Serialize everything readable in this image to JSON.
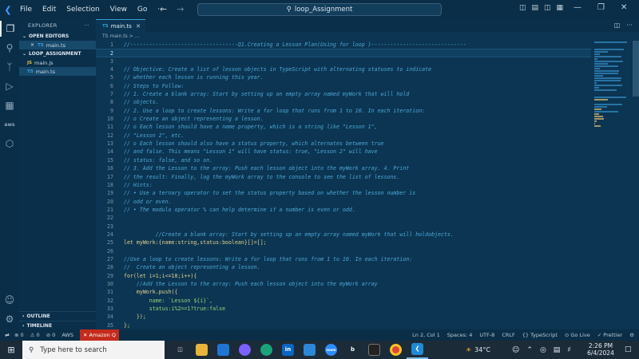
{
  "menu": [
    "File",
    "Edit",
    "Selection",
    "View",
    "Go"
  ],
  "menu_more": "···",
  "command_center": {
    "text": "loop_Assignment"
  },
  "sidebar": {
    "title": "EXPLORER",
    "open_editors_label": "OPEN EDITORS",
    "open_editor_file": "main.ts",
    "project_label": "LOOP_ASSIGNMENT",
    "files": [
      {
        "badge": "JS",
        "name": "main.js"
      },
      {
        "badge": "TS",
        "name": "main.ts"
      }
    ],
    "outline_label": "OUTLINE",
    "timeline_label": "TIMELINE"
  },
  "editor": {
    "tab_badge": "TS",
    "tab_label": "main.ts",
    "breadcrumb": "TS main.ts > ...",
    "lines": [
      {
        "n": "1",
        "t": "//----------------------------------Q1.Creating a Lesson Plan(Using for loop )------------------------------",
        "cls": "c"
      },
      {
        "n": "2",
        "t": "",
        "cls": "c",
        "cur": true
      },
      {
        "n": "3",
        "t": "",
        "cls": "c"
      },
      {
        "n": "4",
        "t": "// Objective: Create a list of lesson objects in TypeScript with alternating statuses to indicate",
        "cls": "c"
      },
      {
        "n": "5",
        "t": "// whether each lesson is running this year.",
        "cls": "c"
      },
      {
        "n": "6",
        "t": "// Steps to Follow:",
        "cls": "c"
      },
      {
        "n": "7",
        "t": "// 1. Create a blank array: Start by setting up an empty array named myWork that will hold",
        "cls": "c"
      },
      {
        "n": "8",
        "t": "// objects.",
        "cls": "c"
      },
      {
        "n": "9",
        "t": "// 2. Use a loop to create lessons: Write a for loop that runs from 1 to 10. In each iteration:",
        "cls": "c"
      },
      {
        "n": "10",
        "t": "// o Create an object representing a lesson.",
        "cls": "c"
      },
      {
        "n": "11",
        "t": "// o Each lesson should have a name property, which is a string like \"Lesson 1\",",
        "cls": "c"
      },
      {
        "n": "12",
        "t": "// \"Lesson 2\", etc.",
        "cls": "c"
      },
      {
        "n": "13",
        "t": "// o Each lesson should also have a status property, which alternates between true",
        "cls": "c"
      },
      {
        "n": "14",
        "t": "// and false. This means \"Lesson 1\" will have status: true, \"Lesson 2\" will have",
        "cls": "c"
      },
      {
        "n": "15",
        "t": "// status: false, and so on.",
        "cls": "c"
      },
      {
        "n": "16",
        "t": "// 3. Add the Lesson to the array: Push each lesson object into the myWork array. 4. Print",
        "cls": "c"
      },
      {
        "n": "17",
        "t": "// the result: Finally, log the myWork array to the console to see the list of lessons.",
        "cls": "c"
      },
      {
        "n": "18",
        "t": "// Hints:",
        "cls": "c"
      },
      {
        "n": "19",
        "t": "// • Use a ternary operator to set the status property based on whether the lesson number is",
        "cls": "c"
      },
      {
        "n": "20",
        "t": "// odd or even.",
        "cls": "c"
      },
      {
        "n": "21",
        "t": "// • The modulo operator % can help determine if a number is even or odd.",
        "cls": "c"
      },
      {
        "n": "22",
        "t": "",
        "cls": "c"
      },
      {
        "n": "23",
        "t": "",
        "cls": "c"
      },
      {
        "n": "24",
        "t": "          //Create a blank array: Start by setting up an empty array named myWork that will holdobjects.",
        "cls": "c"
      },
      {
        "n": "25",
        "t": "let myWork:{name:string,status:boolean}[]=[];",
        "cls": "k"
      },
      {
        "n": "26",
        "t": "",
        "cls": "c"
      },
      {
        "n": "27",
        "t": "//Use a loop to create lessons: Write a for loop that runs from 1 to 10. In each iteration:",
        "cls": "c"
      },
      {
        "n": "28",
        "t": "//  Create an object representing a lesson.",
        "cls": "c"
      },
      {
        "n": "29",
        "t": "for(let i=1;i<=10;i++){",
        "cls": "k"
      },
      {
        "n": "30",
        "t": "    //Add the Lesson to the array: Push each lesson object into the myWork array",
        "cls": "c"
      },
      {
        "n": "31",
        "t": "    myWork.push({",
        "cls": "k"
      },
      {
        "n": "32",
        "t": "        name: `Lesson ${i}`,",
        "cls": "s"
      },
      {
        "n": "33",
        "t": "        status:i%2==1?true:false",
        "cls": "s"
      },
      {
        "n": "34",
        "t": "    });",
        "cls": "k"
      },
      {
        "n": "35",
        "t": "};",
        "cls": "k"
      },
      {
        "n": "36",
        "t": "console.log(myWork);",
        "cls": "k"
      },
      {
        "n": "37",
        "t": "",
        "cls": "c"
      }
    ]
  },
  "statusbar": {
    "errors": "⊗ 0",
    "warnings": "⚠ 0",
    "ports": "⊘ 0",
    "aws": "AWS",
    "amazon_q": "✕ Amazon Q",
    "position": "Ln 2, Col 1",
    "spaces": "Spaces: 4",
    "encoding": "UTF-8",
    "eol": "CRLF",
    "language": "{} TypeScript",
    "golive": "⊙ Go Live",
    "prettier": "✓ Prettier"
  },
  "taskbar": {
    "search_placeholder": "Type here to search",
    "weather": "34°C",
    "time": "2:26 PM",
    "date": "6/4/2024"
  },
  "colors": {
    "accent": "#3b9cd8",
    "amazon_q": "#c42b1c"
  }
}
